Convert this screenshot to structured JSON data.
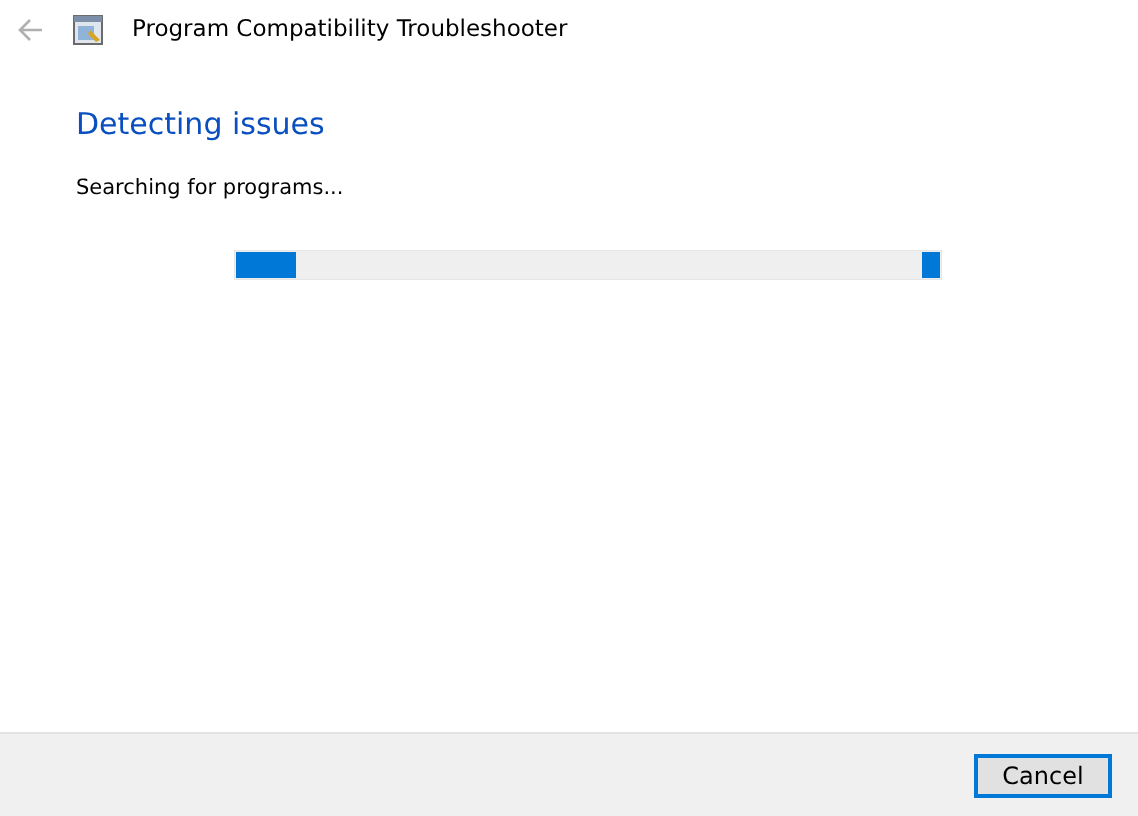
{
  "window": {
    "title": "Program Compatibility Troubleshooter"
  },
  "heading": "Detecting issues",
  "status": "Searching for programs...",
  "progress": {
    "indeterminate": true
  },
  "back_button": {
    "disabled": true
  },
  "buttons": [
    {
      "label": "Cancel",
      "focused": true
    }
  ]
}
